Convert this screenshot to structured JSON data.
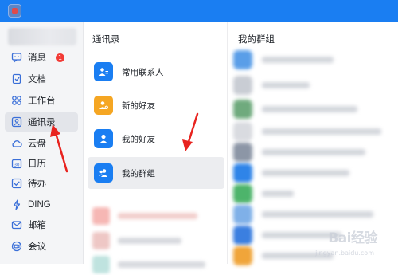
{
  "sidebar": {
    "items": [
      {
        "label": "消息",
        "icon": "chat-icon",
        "badge": "1"
      },
      {
        "label": "文档",
        "icon": "document-icon"
      },
      {
        "label": "工作台",
        "icon": "grid-icon"
      },
      {
        "label": "通讯录",
        "icon": "contacts-icon",
        "active": true
      },
      {
        "label": "云盘",
        "icon": "cloud-icon"
      },
      {
        "label": "日历",
        "icon": "calendar-icon"
      },
      {
        "label": "待办",
        "icon": "checkbox-icon"
      },
      {
        "label": "DING",
        "icon": "lightning-icon"
      },
      {
        "label": "邮箱",
        "icon": "mail-icon"
      },
      {
        "label": "会议",
        "icon": "meeting-icon"
      }
    ]
  },
  "contacts": {
    "title": "通讯录",
    "items": [
      {
        "label": "常用联系人",
        "icon": "frequent-contacts-icon",
        "color": "#1a7ef2"
      },
      {
        "label": "新的好友",
        "icon": "new-friend-icon",
        "color": "#f5a623"
      },
      {
        "label": "我的好友",
        "icon": "friend-icon",
        "color": "#1a7ef2"
      },
      {
        "label": "我的群组",
        "icon": "group-icon",
        "color": "#1a7ef2",
        "active": true
      }
    ]
  },
  "groups": {
    "title": "我的群组"
  },
  "colors": {
    "titlebar": "#1a7ef2",
    "annotation_arrow": "#e8231f",
    "badge": "#f23b36"
  },
  "watermark": {
    "text": "Bai经验",
    "sub": "jingyan.baidu.com"
  }
}
